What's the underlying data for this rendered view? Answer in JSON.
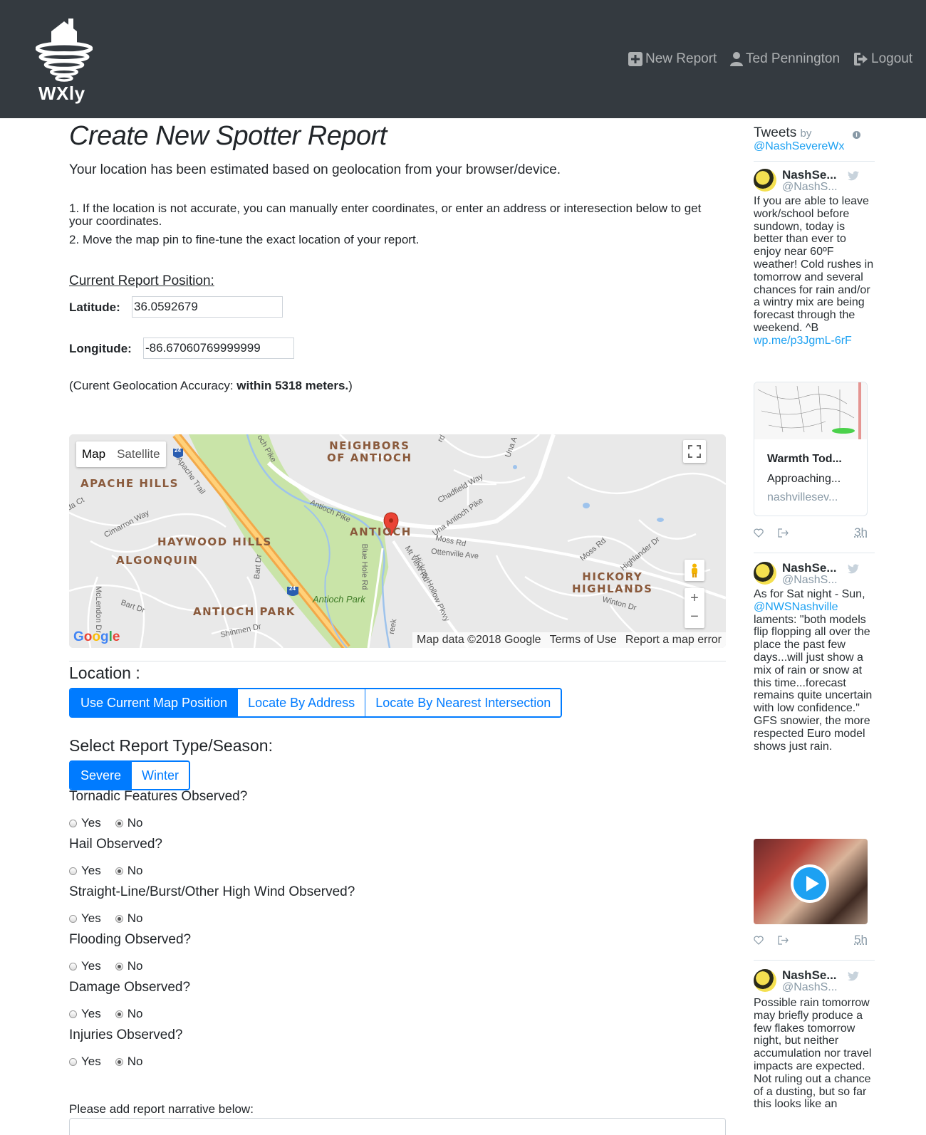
{
  "header": {
    "logo_text": "WXly",
    "nav": {
      "new_report": "New Report",
      "user_name": "Ted Pennington",
      "logout": "Logout"
    }
  },
  "page": {
    "title": "Create New Spotter Report",
    "intro": "Your location has been estimated based on geolocation from your browser/device.",
    "step1": "1. If the location is not accurate, you can manually enter coordinates, or enter an address or interesection below to get your coordinates.",
    "step2": "2. Move the map pin to fine-tune the exact location of your report.",
    "position_heading": "Current Report Position:",
    "latitude_label": "Latitude:",
    "latitude_value": "36.0592679",
    "longitude_label": "Longitude:",
    "longitude_value": "-86.67060769999999",
    "accuracy_prefix": "(Curent Geolocation Accuracy: ",
    "accuracy_value": "within 5318 meters.",
    "accuracy_suffix": ")"
  },
  "map": {
    "type_map": "Map",
    "type_satellite": "Satellite",
    "labels": {
      "neighbors_of_antioch": [
        "NEIGHBORS",
        "OF ANTIOCH"
      ],
      "apache_hills": "APACHE HILLS",
      "haywood_hills": "HAYWOOD HILLS",
      "algonquin": "ALGONQUIN",
      "antioch": "ANTIOCH",
      "antioch_park_area": "ANTIOCH PARK",
      "hickory_highlands": [
        "HICKORY",
        "HIGHLANDS"
      ],
      "antioch_park": "Antioch Park",
      "streets": {
        "apache_trail": "Apache Trail",
        "cimarron_way": "Cimarron Way",
        "antioch_pike": "Antioch Pike",
        "una_antioch_pike": "Una Antioch Pike",
        "chadfield_way": "Chadfield Way",
        "moss_rd": "Moss Rd",
        "ottenville_ave": "Ottenville Ave",
        "mt_view_rd": "Mt View Rd",
        "blue_hole_rd": "Blue Hole Rd",
        "hickory_hollow_pkwy": "Hickory Hollow Pkwy",
        "bart_dr": "Bart Dr",
        "shihmen_dr": "Shihmen Dr",
        "winton_dr": "Winton Dr",
        "highlander_dr": "Highlander Dr",
        "mclendon_dr": "McLendon Dr",
        "moss_rd_2": "Moss Rd",
        "una_a": "Una A",
        "och_pike": "och Pike",
        "da_ct": "da Ct",
        "creek": "reek",
        "rd": "rd",
        "i24": "24"
      }
    },
    "google": "Google",
    "footer": [
      "Map data ©2018 Google",
      "Terms of Use",
      "Report a map error"
    ]
  },
  "location": {
    "title": "Location :",
    "buttons": [
      "Use Current Map Position",
      "Locate By Address",
      "Locate By Nearest Intersection"
    ]
  },
  "report_type": {
    "title": "Select Report Type/Season:",
    "buttons": [
      "Severe",
      "Winter"
    ]
  },
  "questions": [
    {
      "label": "Tornadic Features Observed?",
      "yes": "Yes",
      "no": "No"
    },
    {
      "label": "Hail Observed?",
      "yes": "Yes",
      "no": "No"
    },
    {
      "label": "Straight-Line/Burst/Other High Wind Observed?",
      "yes": "Yes",
      "no": "No"
    },
    {
      "label": "Flooding Observed?",
      "yes": "Yes",
      "no": "No"
    },
    {
      "label": "Damage Observed?",
      "yes": "Yes",
      "no": "No"
    },
    {
      "label": "Injuries Observed?",
      "yes": "Yes",
      "no": "No"
    }
  ],
  "narrative_label": "Please add report narrative below:",
  "twitter": {
    "title": "Tweets",
    "by": "by",
    "account": "@NashSevereWx",
    "tweets": [
      {
        "name": "NashSe...",
        "handle": "@NashS...",
        "text": "If you are able to leave work/school before sundown, today is better than ever to enjoy near 60ºF weather! Cold rushes in tomorrow and several chances for rain and/or a wintry mix are being forecast through the weekend. ^B",
        "link": "wp.me/p3JgmL-6rF",
        "card_title": "Warmth Tod...",
        "card_desc": "Approaching...",
        "card_domain": "nashvillesev...",
        "time": "3h"
      },
      {
        "name": "NashSe...",
        "handle": "@NashS...",
        "text_pre": "As for Sat night - Sun,",
        "mention": "@NWSNashville",
        "text_post": "laments: \"both models flip flopping all over the place the past few days...will just show a mix of rain or snow at this time...forecast remains quite uncertain with low confidence.\" GFS snowier, the more respected Euro model shows just rain.",
        "time": "5h"
      },
      {
        "name": "NashSe...",
        "handle": "@NashS...",
        "text": "Possible rain tomorrow may briefly produce a few flakes tomorrow night, but neither accumulation nor travel impacts are expected. Not ruling out a chance of a dusting, but so far this looks like an"
      }
    ]
  }
}
